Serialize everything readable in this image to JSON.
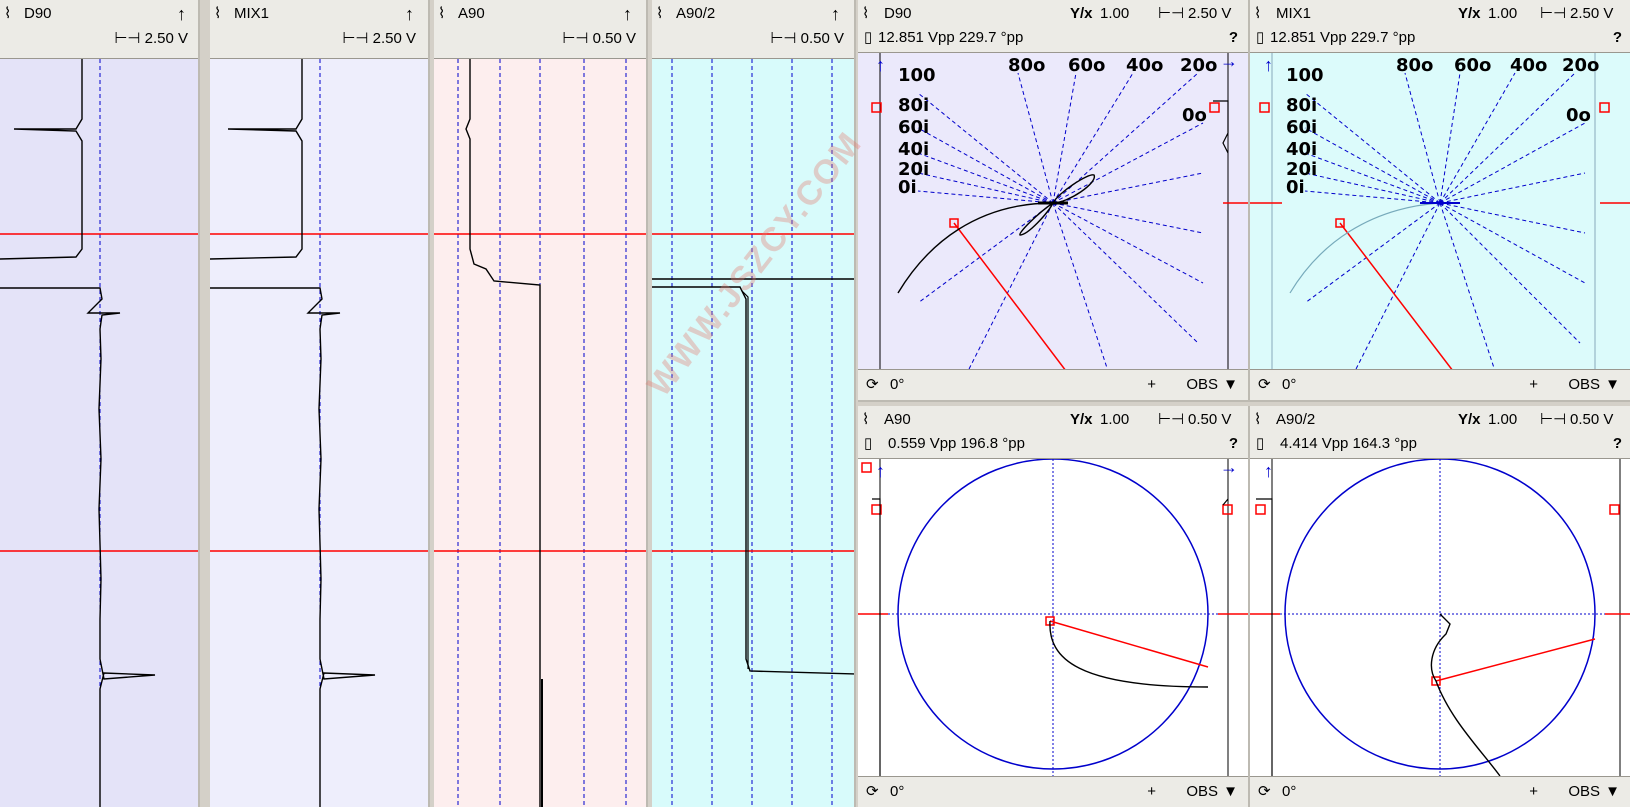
{
  "strips": [
    {
      "name": "D90",
      "range": "2.50 V",
      "bg": "#e4e3f8"
    },
    {
      "name": "MIX1",
      "range": "2.50 V",
      "bg": "#eeeefc"
    },
    {
      "name": "A90",
      "range": "0.50 V",
      "bg": "#fdeeee"
    },
    {
      "name": "A90/2",
      "range": "0.50 V",
      "bg": "#d8fbfb"
    }
  ],
  "lissajous": [
    {
      "name": "D90",
      "ratio": "1.00",
      "range": "2.50 V",
      "measure": "12.851 Vpp 229.7 °pp",
      "rotation": "0°",
      "obs": "OBS",
      "bg": "#ebe9fb",
      "angle_labels_top": [
        "80o",
        "60o",
        "40o",
        "20o"
      ],
      "angle_label_right": "0o",
      "angle_labels_left": [
        "100",
        "80i",
        "60i",
        "40i",
        "20i",
        "0i"
      ]
    },
    {
      "name": "MIX1",
      "ratio": "1.00",
      "range": "2.50 V",
      "measure": "12.851 Vpp 229.7 °pp",
      "rotation": "0°",
      "obs": "OBS",
      "bg": "#dcfbfb",
      "angle_labels_top": [
        "80o",
        "60o",
        "40o",
        "20o"
      ],
      "angle_label_right": "0o",
      "angle_labels_left": [
        "100",
        "80i",
        "60i",
        "40i",
        "20i",
        "0i"
      ]
    },
    {
      "name": "A90",
      "ratio": "1.00",
      "range": "0.50 V",
      "measure": "0.559 Vpp 196.8 °pp",
      "rotation": "0°",
      "obs": "OBS",
      "bg": "#ffffff"
    },
    {
      "name": "A90/2",
      "ratio": "1.00",
      "range": "0.50 V",
      "measure": "4.414 Vpp 164.3 °pp",
      "rotation": "0°",
      "obs": "OBS",
      "bg": "#ffffff"
    }
  ],
  "icons": {
    "up": "↑",
    "right": "→",
    "help": "?",
    "plus": "+",
    "dropdown": "▼",
    "rotate": "⟳"
  },
  "colors": {
    "trace": "#000000",
    "cursor": "#ff0000",
    "grid": "#0000cc"
  },
  "watermark": "WWW.JSZCY.COM"
}
